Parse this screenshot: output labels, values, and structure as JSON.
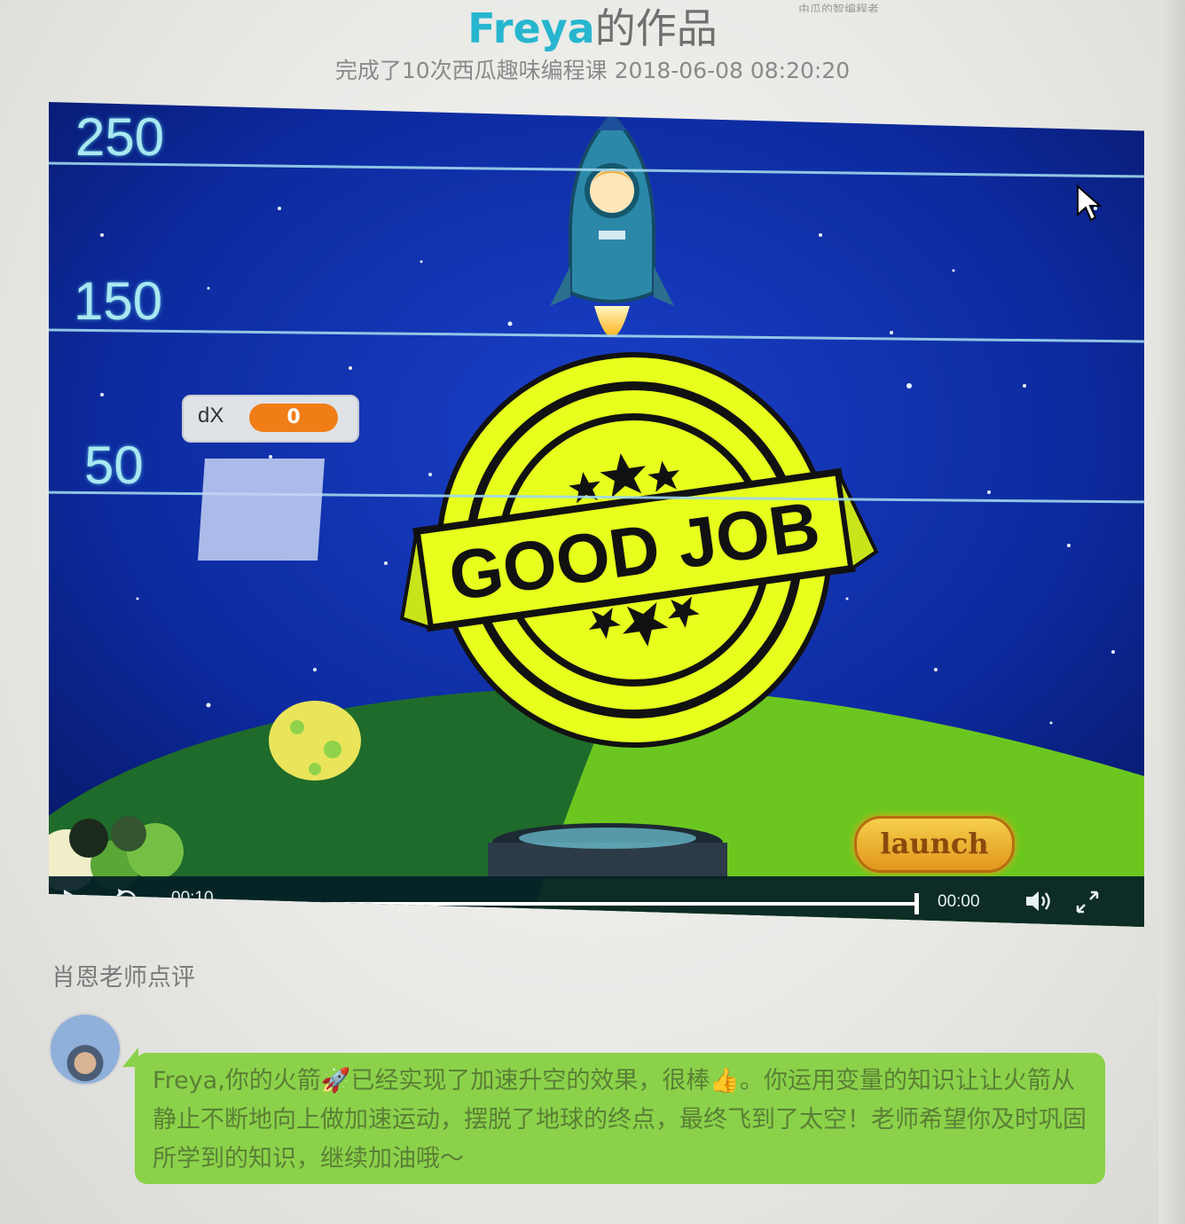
{
  "top_strip": "由瓜的智编程者",
  "header": {
    "name": "Freya",
    "title_suffix": "的作品",
    "subtitle": "完成了10次西瓜趣味编程课 2018-06-08 08:20:20"
  },
  "game": {
    "grid_labels": [
      "250",
      "150",
      "50"
    ],
    "variable": {
      "label": "dX",
      "value": "0"
    },
    "badge_text": "GOOD JOB",
    "launch_label": "launch"
  },
  "player": {
    "current_time": "00:10",
    "end_time": "00:00",
    "progress": 1.0,
    "replay_seconds": "30"
  },
  "review": {
    "title": "肖恩老师点评",
    "comment": "Freya,你的火箭🚀已经实现了加速升空的效果，很棒👍。你运用变量的知识让让火箭从静止不断地向上做加速运动，摆脱了地球的终点，最终飞到了太空！老师希望你及时巩固所学到的知识，继续加油哦～"
  },
  "colors": {
    "brand": "#27b6cf",
    "bubble": "#8bd24a",
    "badge": "#e6ff1c",
    "sky": "#0a2a9c",
    "planet_dark": "#1f6b2b",
    "planet_light": "#6bc71f"
  }
}
